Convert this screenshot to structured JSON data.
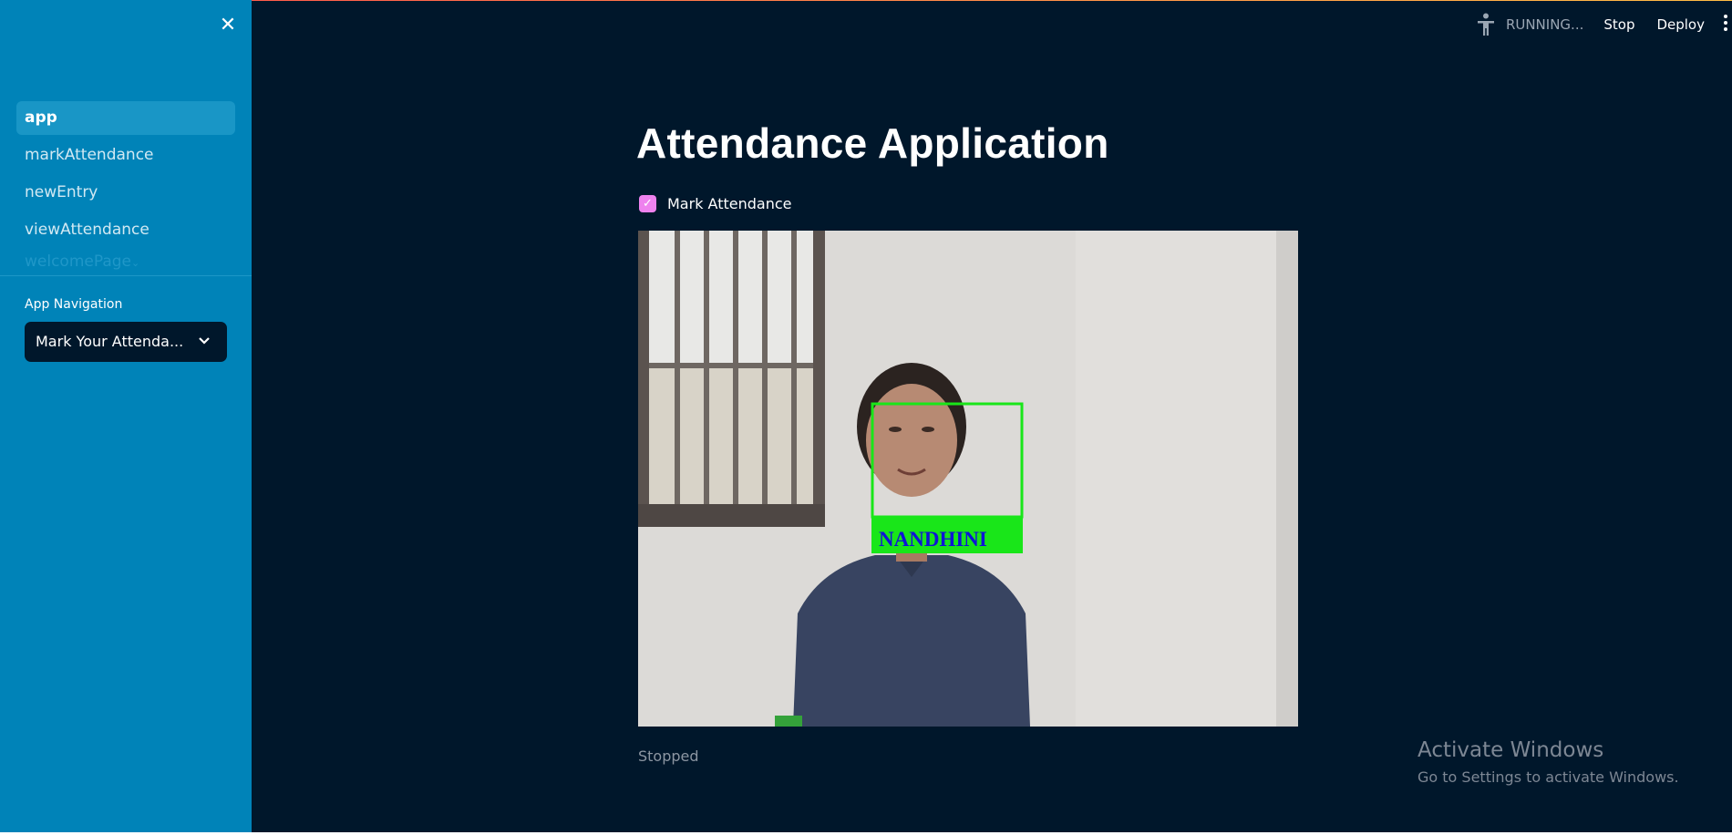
{
  "sidebar": {
    "nav_items": [
      {
        "label": "app",
        "active": true
      },
      {
        "label": "markAttendance",
        "active": false
      },
      {
        "label": "newEntry",
        "active": false
      },
      {
        "label": "viewAttendance",
        "active": false
      },
      {
        "label": "welcomePage",
        "active": false
      }
    ],
    "section_label": "App Navigation",
    "select_value": "Mark Your Attenda...",
    "close_icon": "close-icon",
    "select_icon": "chevron-down-icon"
  },
  "header": {
    "status_icon": "running-man-icon",
    "status_text": "RUNNING...",
    "stop_label": "Stop",
    "deploy_label": "Deploy",
    "menu_icon": "kebab-menu-icon"
  },
  "main": {
    "title": "Attendance Application",
    "checkbox_label": "Mark Attendance",
    "checkbox_checked": true,
    "video": {
      "detected_name": "NANDHINI",
      "box_color": "#19e619",
      "label_color": "#0f15d6"
    },
    "status_text": "Stopped"
  },
  "watermark": {
    "title": "Activate Windows",
    "subtitle": "Go to Settings to activate Windows."
  },
  "colors": {
    "sidebar_bg": "#0083b8",
    "main_bg": "#00172b",
    "checkbox_accent": "#ee82ee"
  }
}
